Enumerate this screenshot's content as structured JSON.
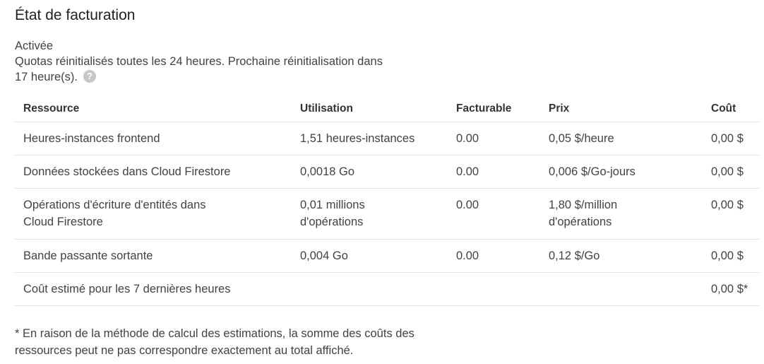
{
  "title": "État de facturation",
  "status": {
    "state": "Activée",
    "quota_line1": "Quotas réinitialisés toutes les 24 heures. Prochaine réinitialisation dans",
    "quota_line2": "17 heure(s).",
    "help_icon": "?"
  },
  "table": {
    "headers": [
      "Ressource",
      "Utilisation",
      "Facturable",
      "Prix",
      "Coût"
    ],
    "rows": [
      {
        "resource": [
          "Heures-instances frontend"
        ],
        "usage": [
          "1,51 heures-instances"
        ],
        "billable": "0.00",
        "price": [
          "0,05 $/heure"
        ],
        "cost": "0,00 $"
      },
      {
        "resource": [
          "Données stockées dans Cloud Firestore"
        ],
        "usage": [
          "0,0018 Go"
        ],
        "billable": "0.00",
        "price": [
          "0,006 $/Go-jours"
        ],
        "cost": "0,00 $"
      },
      {
        "resource": [
          "Opérations d'écriture d'entités dans",
          "Cloud Firestore"
        ],
        "usage": [
          "0,01 millions",
          "d'opérations"
        ],
        "billable": "0.00",
        "price": [
          "1,80 $/million",
          "d'opérations"
        ],
        "cost": "0,00 $"
      },
      {
        "resource": [
          "Bande passante sortante"
        ],
        "usage": [
          "0,004 Go"
        ],
        "billable": "0.00",
        "price": [
          "0,12 $/Go"
        ],
        "cost": "0,00 $"
      }
    ],
    "total": {
      "label": "Coût estimé pour les 7 dernières heures",
      "cost": "0,00 $*"
    }
  },
  "footnote": {
    "line1": "* En raison de la méthode de calcul des estimations, la somme des coûts des",
    "line2": "ressources peut ne pas correspondre exactement au total affiché."
  },
  "colors": {
    "text": "#424242",
    "heading": "#212121",
    "divider": "#e0e0e0",
    "help_icon_bg": "#c7c7c7"
  }
}
